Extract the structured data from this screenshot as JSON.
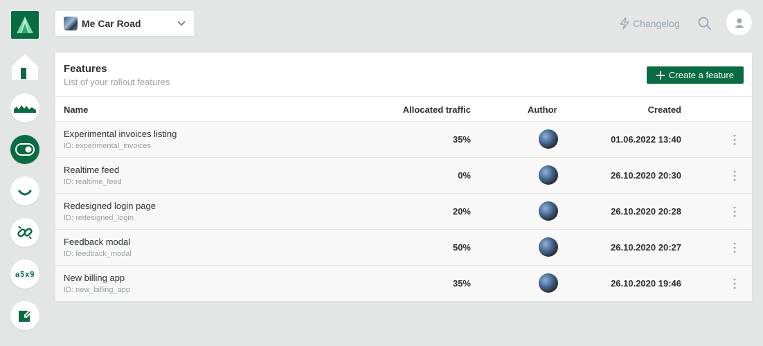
{
  "project": {
    "name": "Me Car Road"
  },
  "topbar": {
    "changelog_label": "Changelog"
  },
  "card": {
    "title": "Features",
    "subtitle": "List of your rollout features",
    "create_label": "Create a feature"
  },
  "columns": {
    "name": "Name",
    "traffic": "Allocated traffic",
    "author": "Author",
    "created": "Created"
  },
  "features": [
    {
      "name": "Experimental invoices listing",
      "id": "ID: experimental_invoices",
      "traffic": "35%",
      "created": "01.06.2022 13:40"
    },
    {
      "name": "Realtime feed",
      "id": "ID: realtime_feed",
      "traffic": "0%",
      "created": "26.10.2020 20:30"
    },
    {
      "name": "Redesigned login page",
      "id": "ID: redesigned_login",
      "traffic": "20%",
      "created": "26.10.2020 20:28"
    },
    {
      "name": "Feedback modal",
      "id": "ID: feedback_modal",
      "traffic": "50%",
      "created": "26.10.2020 20:27"
    },
    {
      "name": "New billing app",
      "id": "ID: new_billing_app",
      "traffic": "35%",
      "created": "26.10.2020 19:46"
    }
  ],
  "sidebar": {
    "items": [
      {
        "icon": "home-icon"
      },
      {
        "icon": "mountains-icon"
      },
      {
        "icon": "toggle-icon"
      },
      {
        "icon": "smile-icon"
      },
      {
        "icon": "link-icon"
      },
      {
        "icon": "api-key-icon",
        "label": "a5x9"
      },
      {
        "icon": "edit-icon"
      }
    ]
  },
  "colors": {
    "brand": "#0a6b43",
    "background": "#e3e6e4"
  }
}
